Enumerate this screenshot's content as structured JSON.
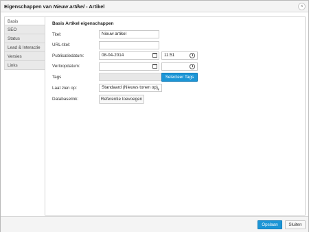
{
  "dialog": {
    "title_prefix": "Eigenschappen van ",
    "title_italic": "Nieuw artikel",
    "title_suffix": " - Artikel",
    "close_glyph": "×"
  },
  "sidebar": {
    "items": [
      {
        "label": "Basis",
        "active": true
      },
      {
        "label": "SEO"
      },
      {
        "label": "Status"
      },
      {
        "label": "Lead & Interactie"
      },
      {
        "label": "Versies"
      },
      {
        "label": "Links"
      }
    ]
  },
  "form": {
    "section_title": "Basis Artikel eigenschappen",
    "titel": {
      "label": "Titel:",
      "value": "Nieuw artikel"
    },
    "url_titel": {
      "label": "URL-titel:",
      "value": ""
    },
    "publicatiedatum": {
      "label": "Publicatiedatum:",
      "date": "08-04-2014",
      "time": "11:51"
    },
    "verloopdatum": {
      "label": "Verloopdatum:",
      "date": "",
      "time": ""
    },
    "tags": {
      "label": "Tags",
      "value": "",
      "button": "Selecteer Tags"
    },
    "laat_zien_op": {
      "label": "Laat zien op:",
      "selected": "Standaard (Nieuws tonen op)"
    },
    "databaselink": {
      "label": "Databaselink:",
      "button": "Referentie toevoegen"
    }
  },
  "footer": {
    "save_label": "Opslaan",
    "close_label": "Sluiten"
  },
  "colors": {
    "accent": "#1b95d6"
  },
  "icons": [
    "close-icon",
    "calendar-icon",
    "clock-icon",
    "chevron-down-icon"
  ]
}
